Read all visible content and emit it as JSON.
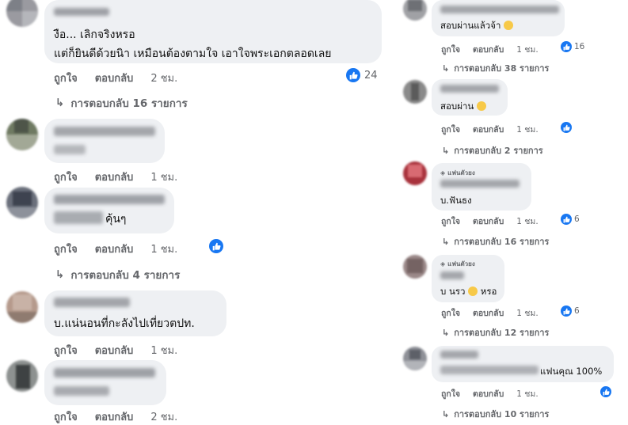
{
  "actions": {
    "like": "ถูกใจ",
    "reply": "ตอบกลับ"
  },
  "left": [
    {
      "line1": "งือ... เลิกจริงหรอ",
      "line2": "แต่ก็ยินดีด้วยนิา เหมือนต้องตามใจ เอาใจพระเอกตลอดเลย",
      "time": "2 ชม.",
      "reactions": "24",
      "replies": "การตอบกลับ 16 รายการ"
    },
    {
      "time": "1 ชม."
    },
    {
      "text": "คุ้นๆ",
      "time": "1 ชม.",
      "replies": "การตอบกลับ 4 รายการ"
    },
    {
      "text": "บ.แน่นอนที่กะลังไปเที่ยวตปท.",
      "time": "1 ชม."
    },
    {
      "time": "2 ชม."
    }
  ],
  "right": [
    {
      "text": "สอบผ่านแล้วจ้า",
      "time": "1 ชม.",
      "reactions": "16",
      "replies": "การตอบกลับ 38 รายการ"
    },
    {
      "text": "สอบผ่าน",
      "time": "1 ชม.",
      "replies": "การตอบกลับ 2 รายการ"
    },
    {
      "badge": "แฟนตัวยง",
      "text": "บ.ฟันธง",
      "time": "1 ชม.",
      "reactions": "6",
      "replies": "การตอบกลับ 16 รายการ"
    },
    {
      "badge": "แฟนตัวยง",
      "text_before": "บ นรว",
      "text_after": "หรอ",
      "time": "1 ชม.",
      "reactions": "6",
      "replies": "การตอบกลับ 12 รายการ"
    },
    {
      "text": "แฟนคุณ 100%",
      "time": "1 ชม.",
      "replies": "การตอบกลับ 10 รายการ"
    }
  ]
}
